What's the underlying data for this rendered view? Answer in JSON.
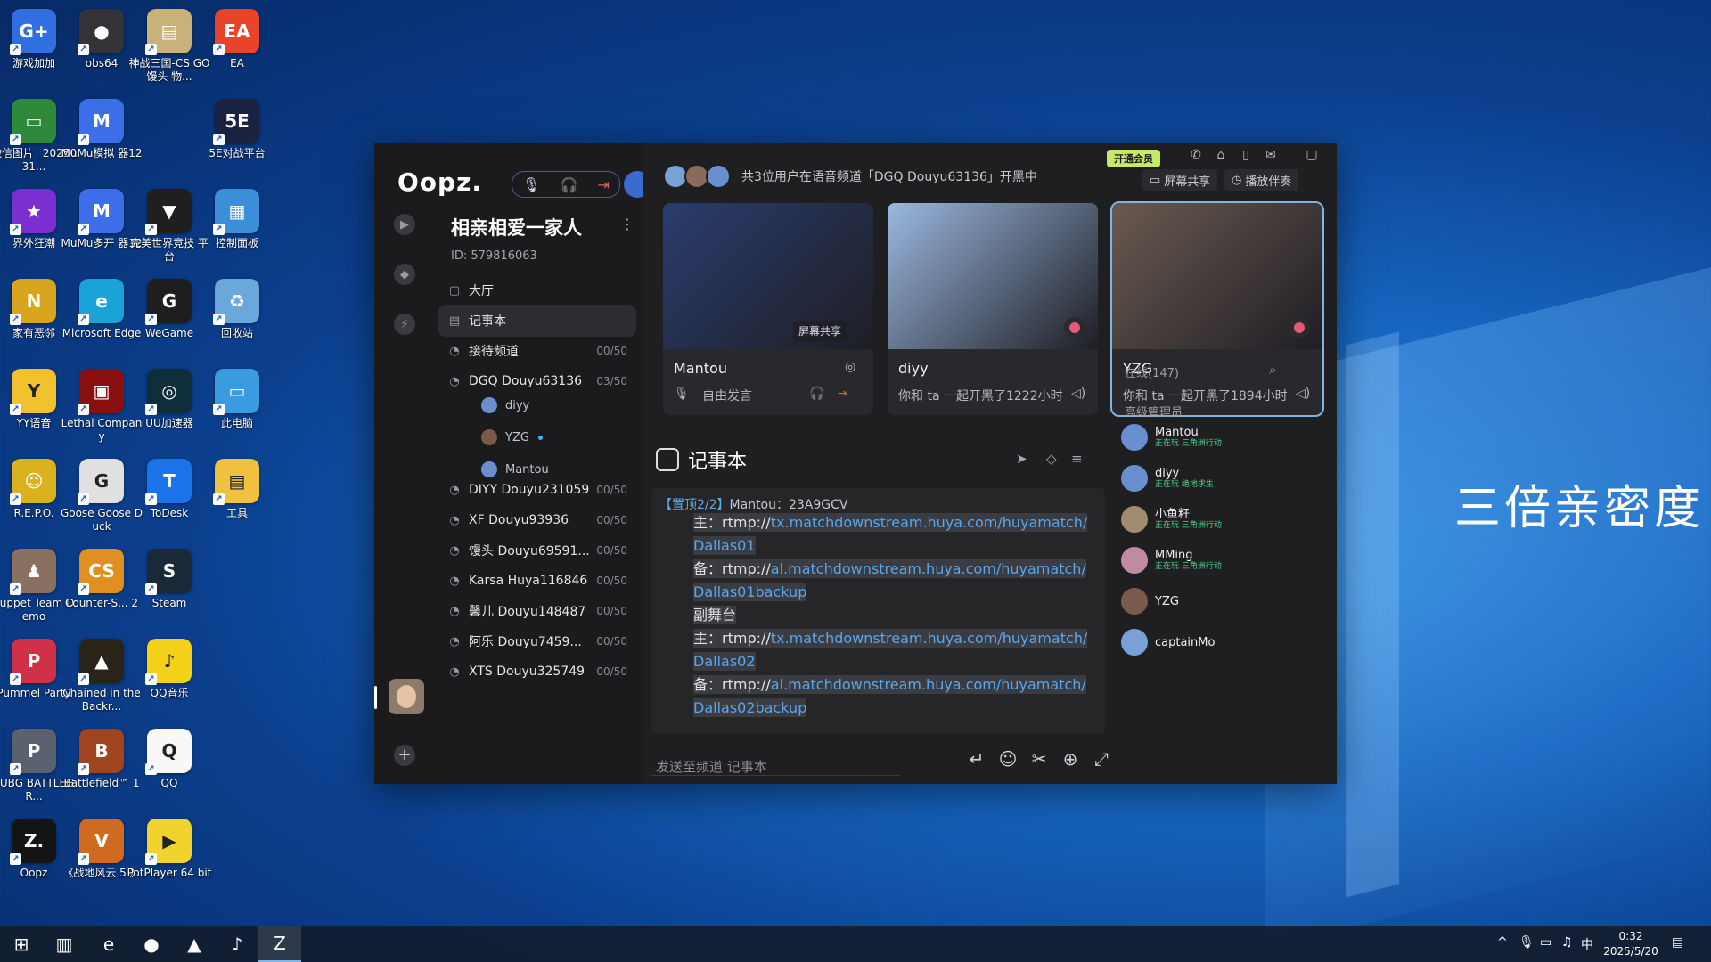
{
  "desktop": {
    "icons": [
      {
        "label": "游戏加加",
        "color": "#2f6fe0",
        "glyph": "G+"
      },
      {
        "label": "obs64",
        "color": "#333338",
        "glyph": "●"
      },
      {
        "label": "神战三国-CS GO馒头 物...",
        "color": "#c8b27a",
        "glyph": "▤"
      },
      {
        "label": "EA",
        "color": "#e8442b",
        "glyph": "EA"
      },
      {
        "label": "微信图片 _2025031...",
        "color": "#2c8a3a",
        "glyph": "▭"
      },
      {
        "label": "MuMu模拟 器12",
        "color": "#3b6ee8",
        "glyph": "M"
      },
      {
        "label": "5E对战平台",
        "color": "#1a2240",
        "glyph": "5E"
      },
      {
        "label": "界外狂潮",
        "color": "#7b2fd0",
        "glyph": "★"
      },
      {
        "label": "MuMu多开 器12",
        "color": "#3b6ee8",
        "glyph": "M"
      },
      {
        "label": "完美世界竞技 平台",
        "color": "#1f1f1f",
        "glyph": "▼"
      },
      {
        "label": "控制面板",
        "color": "#3a8fd8",
        "glyph": "▦"
      },
      {
        "label": "家有恶邻",
        "color": "#d9a51e",
        "glyph": "N"
      },
      {
        "label": "Microsoft Edge",
        "color": "#1aa3d9",
        "glyph": "e"
      },
      {
        "label": "WeGame",
        "color": "#1e1e1e",
        "glyph": "G"
      },
      {
        "label": "回收站",
        "color": "#6aa8dc",
        "glyph": "♻"
      },
      {
        "label": "YY语音",
        "color": "#f2c12e",
        "glyph": "Y"
      },
      {
        "label": "Lethal Company",
        "color": "#8a1010",
        "glyph": "▣"
      },
      {
        "label": "UU加速器",
        "color": "#0e2f3a",
        "glyph": "◎"
      },
      {
        "label": "此电脑",
        "color": "#3a9be0",
        "glyph": "▭"
      },
      {
        "label": "R.E.P.O.",
        "color": "#d9b21e",
        "glyph": "☺"
      },
      {
        "label": "Goose Goose Duck",
        "color": "#e0e0e0",
        "glyph": "G"
      },
      {
        "label": "ToDesk",
        "color": "#1a73e8",
        "glyph": "T"
      },
      {
        "label": "工具",
        "color": "#f0c040",
        "glyph": "▤"
      },
      {
        "label": "Puppet Team Demo",
        "color": "#8a7060",
        "glyph": "♟"
      },
      {
        "label": "Counter-S... 2",
        "color": "#e09020",
        "glyph": "CS"
      },
      {
        "label": "Steam",
        "color": "#1b2838",
        "glyph": "S"
      },
      {
        "label": "Pummel Party",
        "color": "#d03048",
        "glyph": "P"
      },
      {
        "label": "Chained in the Backr...",
        "color": "#2a2418",
        "glyph": "▲"
      },
      {
        "label": "QQ音乐",
        "color": "#f5d21a",
        "glyph": "♪"
      },
      {
        "label": "PUBG BATTLEGR...",
        "color": "#5a6270",
        "glyph": "P"
      },
      {
        "label": "Battlefield™ 1",
        "color": "#a04420",
        "glyph": "B"
      },
      {
        "label": "QQ",
        "color": "#f8f8f8",
        "glyph": "Q"
      },
      {
        "label": "Oopz",
        "color": "#141414",
        "glyph": "Z."
      },
      {
        "label": "《战地风云 5 》",
        "color": "#d06a20",
        "glyph": "V"
      },
      {
        "label": "PotPlayer 64 bit",
        "color": "#f2d22e",
        "glyph": "▶"
      }
    ]
  },
  "app": {
    "logo": "Oopz.",
    "vip_badge": "开通会员",
    "server": {
      "name": "相亲相爱一家人",
      "id": "ID: 579816063"
    },
    "channels": [
      {
        "name": "大厅",
        "count": "",
        "icon": "lobby-icon"
      },
      {
        "name": "记事本",
        "count": "",
        "icon": "notebook-icon",
        "active": true
      },
      {
        "name": "接待频道",
        "count": "00/50",
        "icon": "voice-icon"
      },
      {
        "name": "DGQ Douyu63136",
        "count": "03/50",
        "icon": "voice-icon"
      },
      {
        "name": "DIYY Douyu231059",
        "count": "00/50",
        "icon": "voice-icon"
      },
      {
        "name": "XF Douyu93936",
        "count": "00/50",
        "icon": "voice-icon"
      },
      {
        "name": "馒头 Douyu69591...",
        "count": "00/50",
        "icon": "voice-icon"
      },
      {
        "name": "Karsa Huya116846",
        "count": "00/50",
        "icon": "voice-icon"
      },
      {
        "name": "馨儿 Douyu148487",
        "count": "00/50",
        "icon": "voice-icon"
      },
      {
        "name": "阿乐 Douyu7459...",
        "count": "00/50",
        "icon": "voice-icon"
      },
      {
        "name": "XTS Douyu325749",
        "count": "00/50",
        "icon": "voice-icon"
      }
    ],
    "channel_users": [
      {
        "name": "diyy",
        "color": "#6a8fd0"
      },
      {
        "name": "YZG",
        "color": "#7a5a4a"
      },
      {
        "name": "Mantou",
        "color": "#6a8fd0"
      }
    ],
    "voice_info": "共3位用户在语音频道「DGQ Douyu63136」开黑中",
    "top_buttons": {
      "screen_share": "屏幕共享",
      "play_together": "播放伴奏"
    },
    "cards": [
      {
        "name": "Mantou",
        "sub": "自由发言",
        "share_tag": "屏幕共享",
        "pic_color": "#2a3d6e"
      },
      {
        "name": "diyy",
        "sub": "你和 ta 一起开黑了1222小时",
        "pic_color": "#9bb8e0"
      },
      {
        "name": "YZG",
        "sub": "你和 ta 一起开黑了1894小时",
        "pic_color": "#6a5a50"
      }
    ],
    "notebook": {
      "title": "记事本",
      "pin": {
        "tag": "【置顶2/2】",
        "text": "Mantou：23A9GCV"
      },
      "lines": [
        {
          "prefix": "主：rtmp://",
          "link": "tx.matchdownstream.huya.com/huyamatch/"
        },
        {
          "prefix": "",
          "link": "Dallas01"
        },
        {
          "prefix": "备：rtmp://",
          "link": "al.matchdownstream.huya.com/huyamatch/"
        },
        {
          "prefix": "",
          "link": "Dallas01backup"
        },
        {
          "prefix": "副舞台",
          "link": ""
        },
        {
          "prefix": "主：rtmp://",
          "link": "tx.matchdownstream.huya.com/huyamatch/"
        },
        {
          "prefix": "",
          "link": "Dallas02"
        },
        {
          "prefix": "备：rtmp://",
          "link": "al.matchdownstream.huya.com/huyamatch/"
        },
        {
          "prefix": "",
          "link": "Dallas02backup"
        }
      ],
      "input_placeholder": "发送至频道 记事本"
    },
    "members": {
      "online": "在线(147)",
      "group": "高级管理员",
      "list": [
        {
          "name": "Mantou",
          "status": "正在玩 三角洲行动",
          "color": "#6a8fd0"
        },
        {
          "name": "diyy",
          "status": "正在玩 绝地求生",
          "color": "#6a8fd0"
        },
        {
          "name": "小鱼籽",
          "status": "正在玩 三角洲行动",
          "color": "#a08a70"
        },
        {
          "name": "MMing",
          "status": "正在玩 三角洲行动",
          "color": "#c08aa0"
        },
        {
          "name": "YZG",
          "status": "",
          "color": "#7a5a4a"
        },
        {
          "name": "captainMo",
          "status": "",
          "color": "#7aa0d8"
        }
      ]
    }
  },
  "overlay_text": "三倍亲密度",
  "taskbar": {
    "time": "0:32",
    "date": "2025/5/20",
    "ime": "中"
  }
}
